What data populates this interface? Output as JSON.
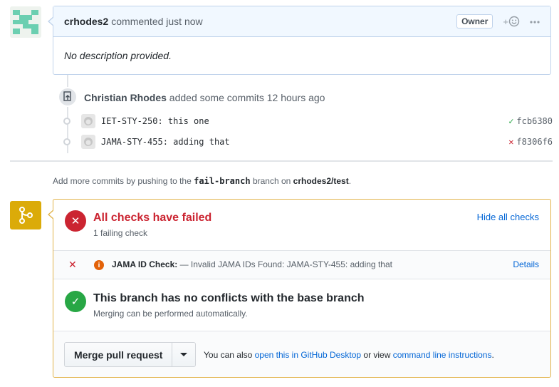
{
  "comment": {
    "author": "crhodes2",
    "action": "commented just now",
    "badge": "Owner",
    "reaction_icon": "smiley-icon",
    "body": "No description provided."
  },
  "push": {
    "actor": "Christian Rhodes",
    "text": "added some commits 12 hours ago",
    "commits": [
      {
        "message": "IET-STY-250: this one",
        "sha": "fcb6380",
        "status": "success"
      },
      {
        "message": "JAMA-STY-455: adding that",
        "sha": "f8306f6",
        "status": "failure"
      }
    ]
  },
  "hint": {
    "prefix": "Add more commits by pushing to the",
    "branch": "fail-branch",
    "mid": "branch on",
    "repo": "crhodes2/test",
    "suffix": "."
  },
  "merge": {
    "checks_title": "All checks have failed",
    "checks_sub": "1 failing check",
    "hide_label": "Hide all checks",
    "check": {
      "name": "JAMA ID Check:",
      "description": "— Invalid JAMA IDs Found: JAMA-STY-455: adding that",
      "details_label": "Details"
    },
    "conflict_title": "This branch has no conflicts with the base branch",
    "conflict_sub": "Merging can be performed automatically.",
    "merge_button": "Merge pull request",
    "also_prefix": "You can also",
    "desktop_link": "open this in GitHub Desktop",
    "also_mid": "or view",
    "cli_link": "command line instructions",
    "also_suffix": "."
  },
  "colors": {
    "fail": "#cb2431",
    "success": "#28a745",
    "link": "#0366d6",
    "warning": "#dbab09"
  }
}
